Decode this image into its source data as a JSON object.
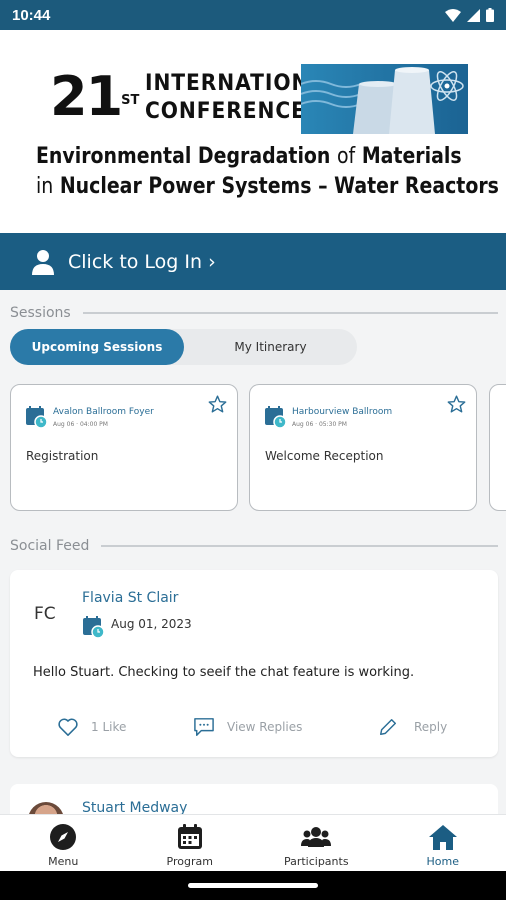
{
  "status_bar": {
    "time": "10:44"
  },
  "banner": {
    "ordinal": "21",
    "ordinal_suffix": "ST",
    "line1": "INTERNATIONAL",
    "line2": "CONFERENCE ON",
    "sub_part1": "Environmental Degradation ",
    "sub_of": "of",
    "sub_part2": " Materials",
    "sub_in": "in",
    "sub_line2": " Nuclear Power Systems – Water Reactors"
  },
  "login": {
    "label": "Click to Log In",
    "chevron": "›"
  },
  "sessions": {
    "heading": "Sessions",
    "tabs": [
      {
        "label": "Upcoming Sessions",
        "active": true
      },
      {
        "label": "My Itinerary",
        "active": false
      }
    ],
    "cards": [
      {
        "room": "Avalon Ballroom Foyer",
        "when": "Aug 06 · 04:00 PM",
        "title": "Registration"
      },
      {
        "room": "Harbourview Ballroom",
        "when": "Aug 06 · 05:30 PM",
        "title": "Welcome Reception"
      }
    ]
  },
  "social": {
    "heading": "Social Feed",
    "posts": [
      {
        "initials": "FC",
        "author": "Flavia St Clair",
        "date": "Aug 01, 2023",
        "body": "Hello Stuart. Checking to seeif the chat feature is working.",
        "like_label": "1 Like",
        "replies_label": "View Replies",
        "reply_label": "Reply"
      },
      {
        "author": "Stuart Medway"
      }
    ]
  },
  "bottom_nav": [
    {
      "label": "Menu",
      "icon": "compass-icon"
    },
    {
      "label": "Program",
      "icon": "calendar-icon"
    },
    {
      "label": "Participants",
      "icon": "people-icon"
    },
    {
      "label": "Home",
      "icon": "home-icon",
      "active": true
    }
  ],
  "colors": {
    "primary": "#1b5d83",
    "accent": "#2b7aa8",
    "status_bar": "#1c5a7c"
  }
}
